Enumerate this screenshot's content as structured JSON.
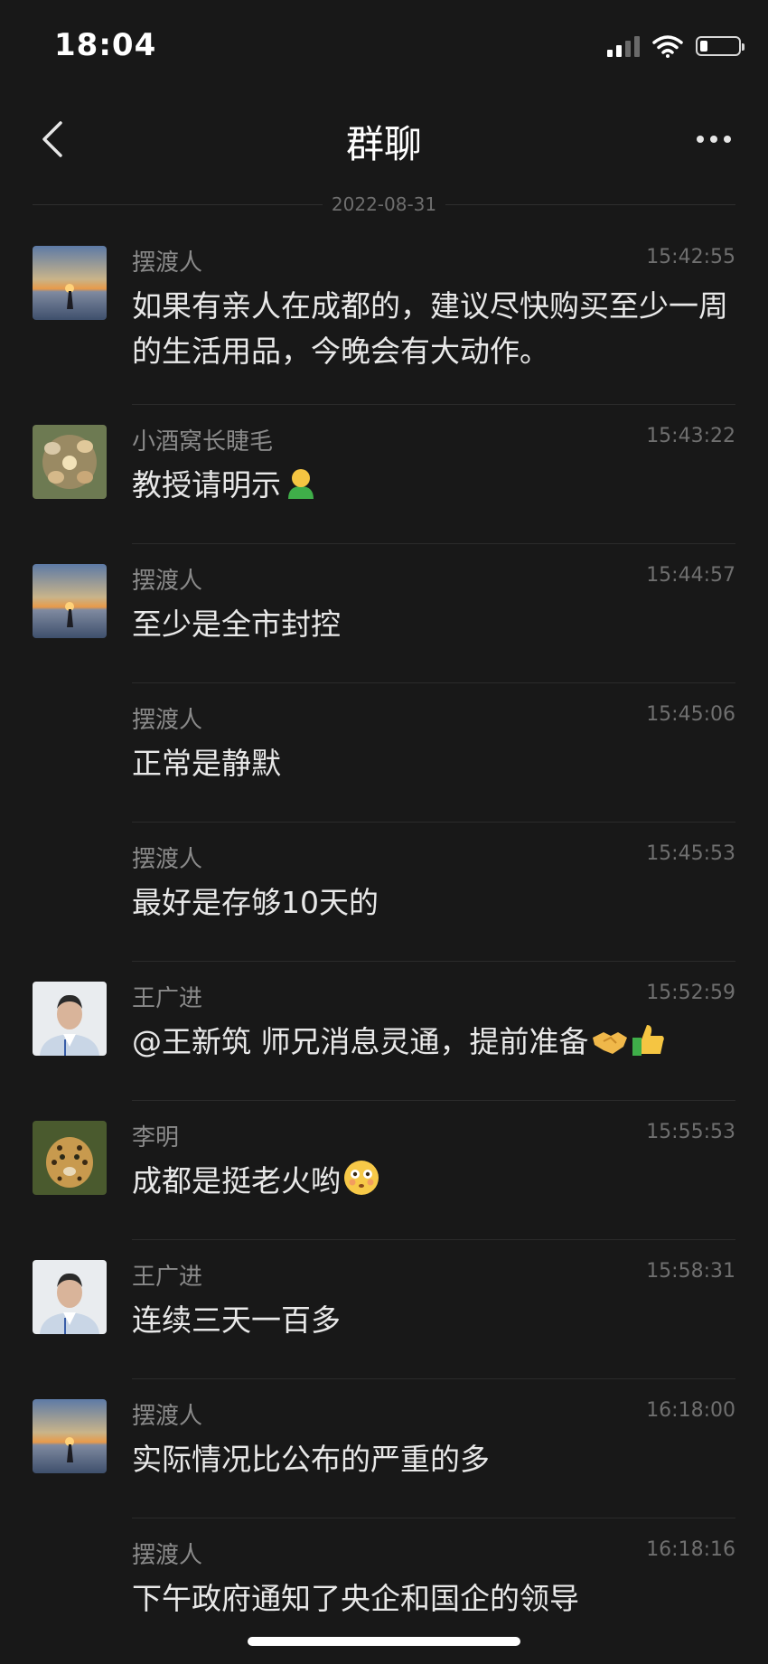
{
  "status_bar": {
    "time": "18:04",
    "battery_level": 0.2
  },
  "header": {
    "title": "群聊"
  },
  "date_divider": "2022-08-31",
  "messages": [
    {
      "sender": "摆渡人",
      "time": "15:42:55",
      "text": "如果有亲人在成都的，建议尽快购买至少一周的生活用品，今晚会有大动作。",
      "avatar": "sunset-avatar"
    },
    {
      "sender": "小酒窝长睫毛",
      "time": "15:43:22",
      "text": "教授请明示",
      "emoji": "person-green-emoji",
      "avatar": "toast-avatar"
    },
    {
      "sender": "摆渡人",
      "time": "15:44:57",
      "text": "至少是全市封控",
      "avatar": "sunset-avatar"
    },
    {
      "sender": "摆渡人",
      "time": "15:45:06",
      "text": "正常是静默",
      "avatar": "none"
    },
    {
      "sender": "摆渡人",
      "time": "15:45:53",
      "text": "最好是存够10天的",
      "avatar": "none"
    },
    {
      "sender": "王广进",
      "time": "15:52:59",
      "text": "@王新筑 师兄消息灵通，提前准备",
      "emoji": "handshake-thumbsup-emoji",
      "avatar": "man-portrait-avatar"
    },
    {
      "sender": "李明",
      "time": "15:55:53",
      "text": "成都是挺老火哟",
      "emoji": "flushed-face-emoji",
      "avatar": "leopard-avatar"
    },
    {
      "sender": "王广进",
      "time": "15:58:31",
      "text": "连续三天一百多",
      "avatar": "man-portrait-avatar"
    },
    {
      "sender": "摆渡人",
      "time": "16:18:00",
      "text": "实际情况比公布的严重的多",
      "avatar": "sunset-avatar"
    },
    {
      "sender": "摆渡人",
      "time": "16:18:16",
      "text": "下午政府通知了央企和国企的领导",
      "avatar": "none"
    }
  ]
}
